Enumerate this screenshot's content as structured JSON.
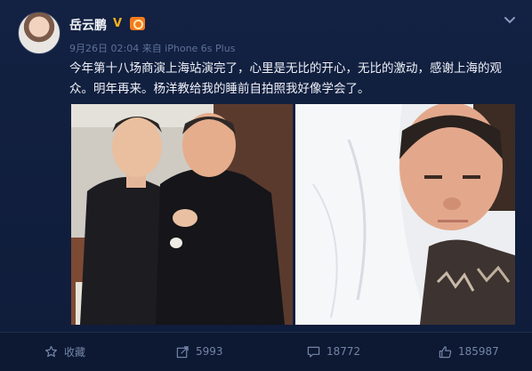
{
  "post": {
    "username": "岳云鹏",
    "verified_badge": "V",
    "meta": "9月26日 02:04 来自 iPhone 6s Plus",
    "text": "今年第十八场商演上海站演完了，心里是无比的开心，无比的激动，感谢上海的观众。明年再来。杨洋教给我的睡前自拍照我好像学会了。"
  },
  "actions": {
    "favorite_label": "收藏",
    "share_count": "5993",
    "comment_count": "18772",
    "like_count": "185987"
  },
  "icons": {
    "verify": "verified-v-icon",
    "vip": "vip-crown-icon",
    "more": "chevron-down-icon",
    "favorite": "star-icon",
    "share": "share-icon",
    "comment": "comment-icon",
    "like": "thumbs-up-icon"
  },
  "colors": {
    "background": "#0e1a36",
    "verify": "#f6b21b",
    "action_text": "#7385a8"
  }
}
